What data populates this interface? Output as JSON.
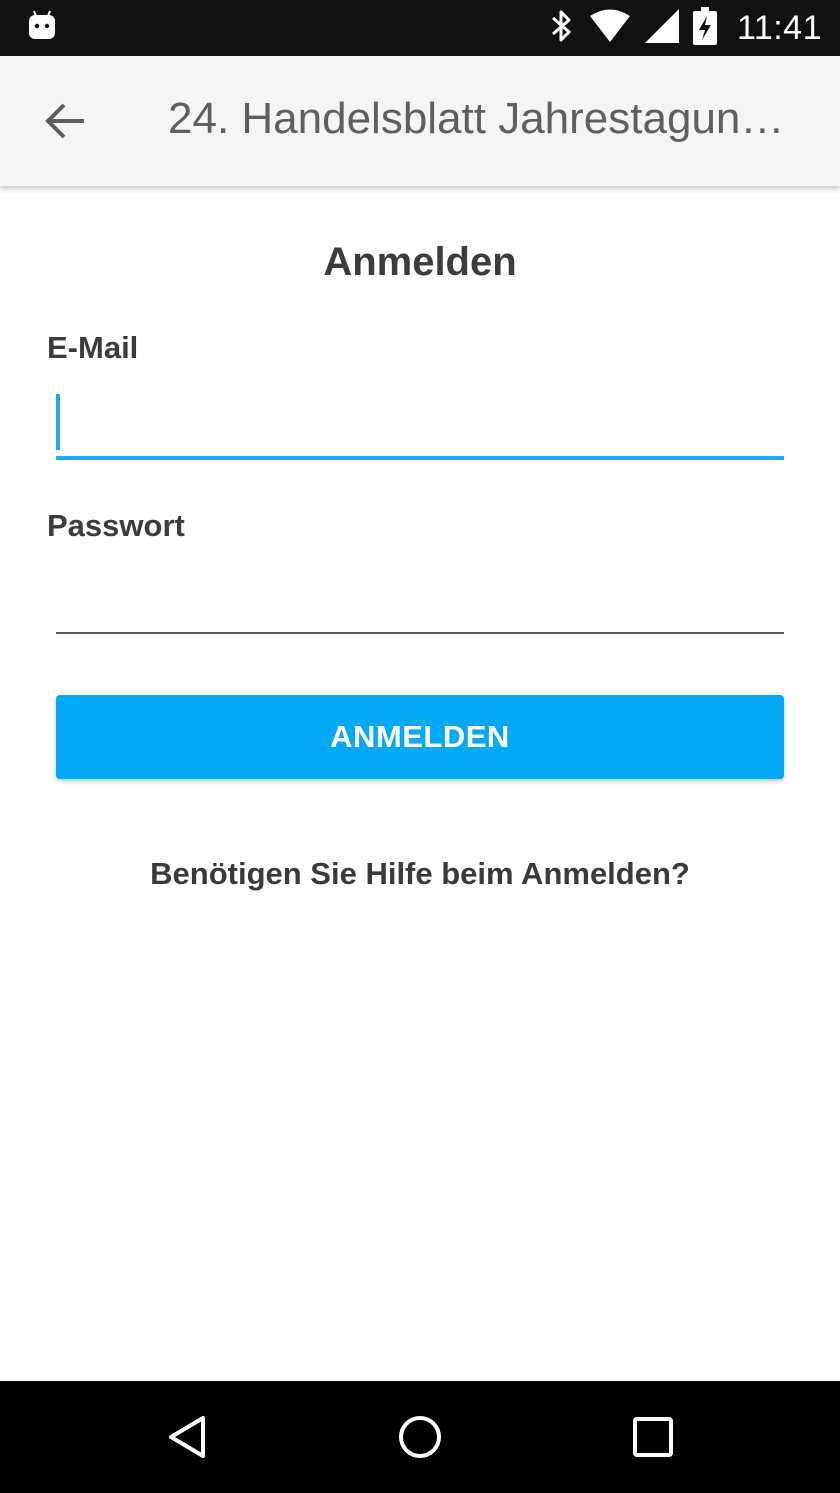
{
  "status_bar": {
    "time": "11:41",
    "icons": [
      "android-notification-icon",
      "bluetooth-icon",
      "wifi-icon",
      "signal-icon",
      "battery-charging-icon"
    ]
  },
  "app_bar": {
    "title": "24. Handelsblatt Jahrestagun…",
    "back_icon": "arrow-left-icon"
  },
  "login": {
    "heading": "Anmelden",
    "email_label": "E-Mail",
    "email_value": "",
    "password_label": "Passwort",
    "password_value": "",
    "submit_label": "ANMELDEN",
    "help_link": "Benötigen Sie Hilfe beim Anmelden?"
  },
  "nav_bar": {
    "icons": [
      "nav-back-icon",
      "nav-home-icon",
      "nav-recents-icon"
    ]
  },
  "colors": {
    "accent": "#03a9f4",
    "input_focus": "#1ea9f2",
    "text_dark": "#3c3c3c",
    "appbar_bg": "#f5f5f5"
  }
}
